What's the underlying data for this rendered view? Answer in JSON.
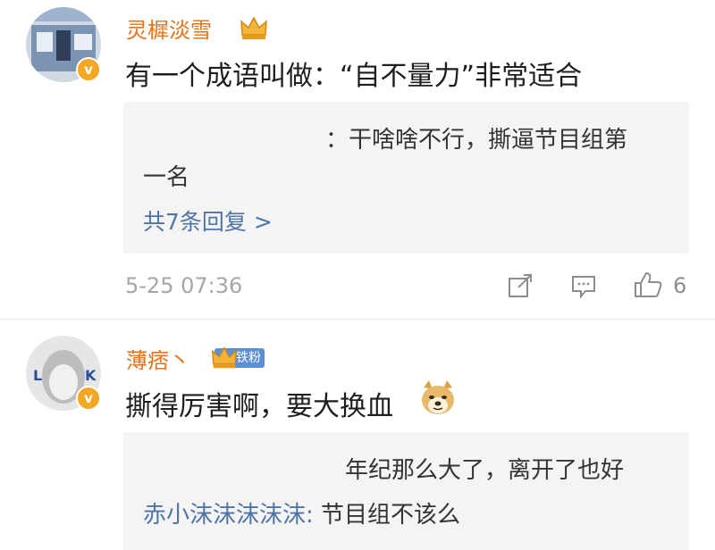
{
  "comments": [
    {
      "username": "灵樨淡雪",
      "text": "有一个成语叫做：“自不量力”非常适合",
      "reply_line1": "：干啥啥不行，撕逼节目组第",
      "reply_line2": "一名",
      "more_replies": "共7条回复 >",
      "time": "5-25 07:36",
      "likes": "6"
    },
    {
      "username": "薄痞丶",
      "fan_badge": "铁粉",
      "text": "撕得厉害啊，要大换血",
      "reply1_text": "年纪那么大了，离开了也好",
      "reply2_user": "赤小沫沫沫沫沫:",
      "reply2_text": " 节目组不该么"
    }
  ],
  "colors": {
    "username": "#e8731d",
    "reply_user": "#4f74a8",
    "meta": "#a6a6a6",
    "badge": "#5b8fd6",
    "verified": "#f5a623"
  },
  "icons": [
    "verified-badge-icon",
    "crown-vip-icon",
    "share-icon",
    "comment-icon",
    "like-icon",
    "doge-emoji-icon"
  ]
}
